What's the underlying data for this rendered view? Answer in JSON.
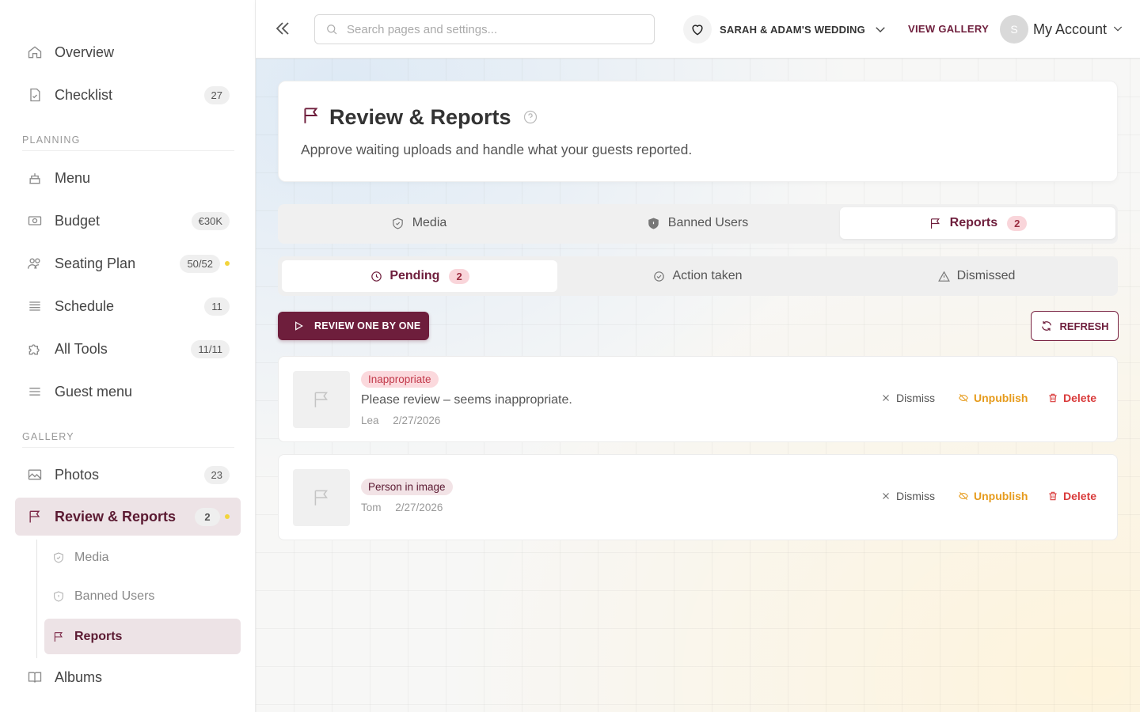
{
  "sidebar": {
    "items": [
      {
        "label": "Overview",
        "icon": "home-icon"
      },
      {
        "label": "Checklist",
        "icon": "checklist-icon",
        "badge": "27"
      },
      {
        "label": "Menu",
        "icon": "cake-icon"
      },
      {
        "label": "Budget",
        "icon": "money-icon",
        "badge": "€30K"
      },
      {
        "label": "Seating Plan",
        "icon": "people-icon",
        "badge": "50/52"
      },
      {
        "label": "Schedule",
        "icon": "list-icon",
        "badge": "11"
      },
      {
        "label": "All Tools",
        "icon": "puzzle-icon",
        "badge": "11/11"
      },
      {
        "label": "Guest menu",
        "icon": "menu-icon"
      },
      {
        "label": "Photos",
        "icon": "image-icon",
        "badge": "23"
      },
      {
        "label": "Review & Reports",
        "icon": "flag-icon",
        "badge": "2"
      },
      {
        "label": "Albums",
        "icon": "book-icon"
      }
    ],
    "sections": {
      "planning": "PLANNING",
      "gallery": "GALLERY"
    },
    "sub_items": [
      {
        "label": "Media",
        "icon": "shield-check-icon"
      },
      {
        "label": "Banned Users",
        "icon": "shield-icon"
      },
      {
        "label": "Reports",
        "icon": "flag-icon"
      }
    ]
  },
  "topbar": {
    "search_placeholder": "Search pages and settings...",
    "wedding_name": "SARAH & ADAM'S WEDDING",
    "view_gallery": "VIEW GALLERY",
    "avatar_initial": "S",
    "account_label": "My Account"
  },
  "page": {
    "title": "Review & Reports",
    "subtitle": "Approve waiting uploads and handle what your guests reported."
  },
  "tabs": [
    {
      "label": "Media"
    },
    {
      "label": "Banned Users"
    },
    {
      "label": "Reports",
      "count": "2"
    }
  ],
  "subtabs": [
    {
      "label": "Pending",
      "count": "2"
    },
    {
      "label": "Action taken"
    },
    {
      "label": "Dismissed"
    }
  ],
  "actions": {
    "review_one_by_one": "REVIEW ONE BY ONE",
    "refresh": "REFRESH"
  },
  "reports": [
    {
      "reason": "Inappropriate",
      "message": "Please review – seems inappropriate.",
      "author": "Lea",
      "date": "2/27/2026"
    },
    {
      "reason": "Person in image",
      "message": "",
      "author": "Tom",
      "date": "2/27/2026"
    }
  ],
  "report_actions": {
    "dismiss": "Dismiss",
    "unpublish": "Unpublish",
    "delete": "Delete"
  },
  "colors": {
    "accent": "#6e1e3c",
    "warning": "#e69b1c",
    "danger": "#d93a3a",
    "badge_bg": "#f9d5da"
  }
}
